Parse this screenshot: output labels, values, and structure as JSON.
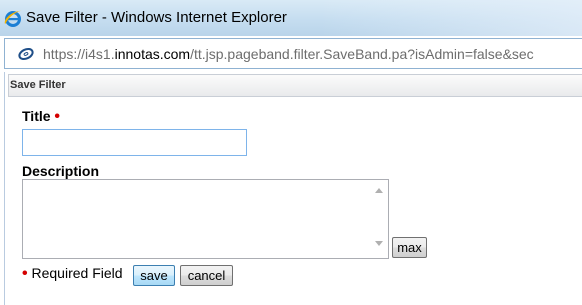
{
  "window": {
    "title": "Save Filter - Windows Internet Explorer"
  },
  "address_bar": {
    "url_prefix": "https://i4s1.",
    "url_domain": "innotas.com",
    "url_path": "/tt.jsp.pageband.filter.SaveBand.pa?isAdmin=false&sec"
  },
  "panel": {
    "title": "Save Filter"
  },
  "form": {
    "title_label": "Title",
    "title_value": "",
    "description_label": "Description",
    "description_value": "",
    "max_button": "max",
    "required_marker": "•",
    "required_note": "Required Field",
    "save_button": "save",
    "cancel_button": "cancel"
  },
  "colors": {
    "required": "#d40000",
    "focus_border": "#7eb4ea"
  },
  "icons": {
    "browser": "internet-explorer-icon",
    "page": "page-icon"
  }
}
